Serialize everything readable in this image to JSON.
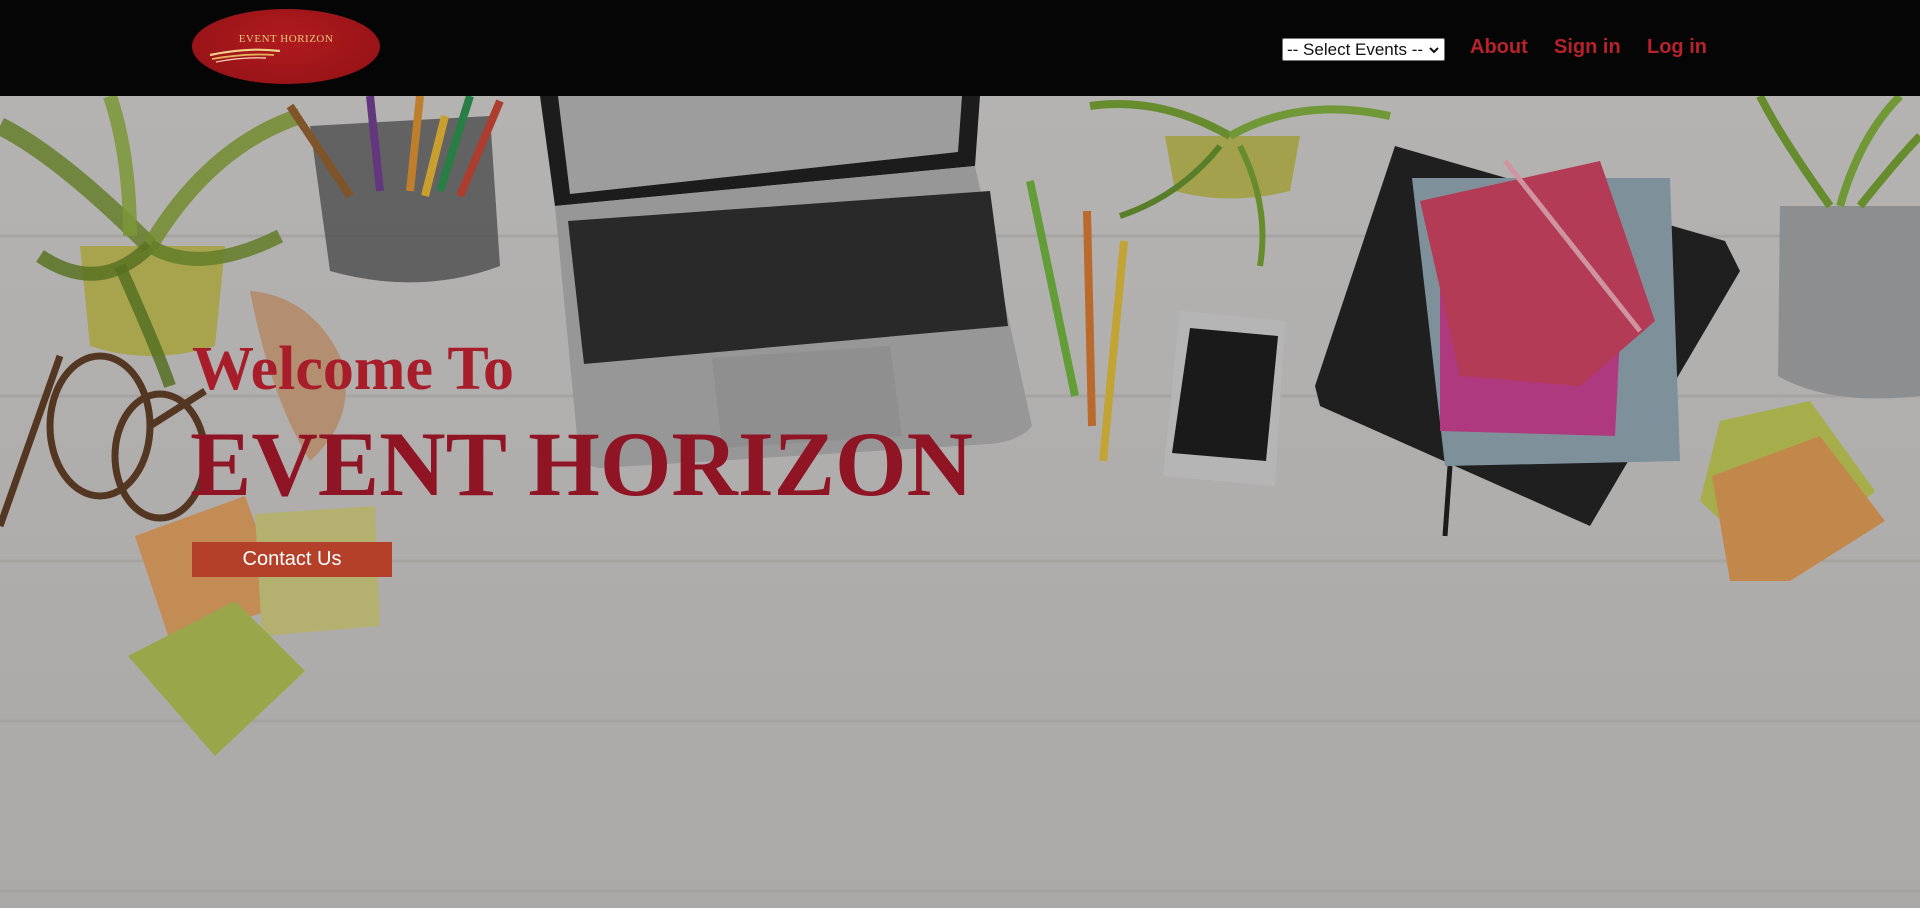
{
  "navbar": {
    "logo_text": "EVENT HORIZON",
    "event_select": {
      "selected": "-- Select Events --"
    },
    "links": {
      "about": "About",
      "sign_in": "Sign in",
      "log_in": "Log in"
    }
  },
  "hero": {
    "welcome": "Welcome To",
    "title": "EVENT HORIZON",
    "contact_button": "Contact Us"
  },
  "colors": {
    "accent": "#b8232b",
    "title": "#8f1524",
    "button": "#b5402a",
    "navbar_bg": "#050505"
  },
  "icons": {
    "select_arrow": "chevron-down-icon"
  }
}
